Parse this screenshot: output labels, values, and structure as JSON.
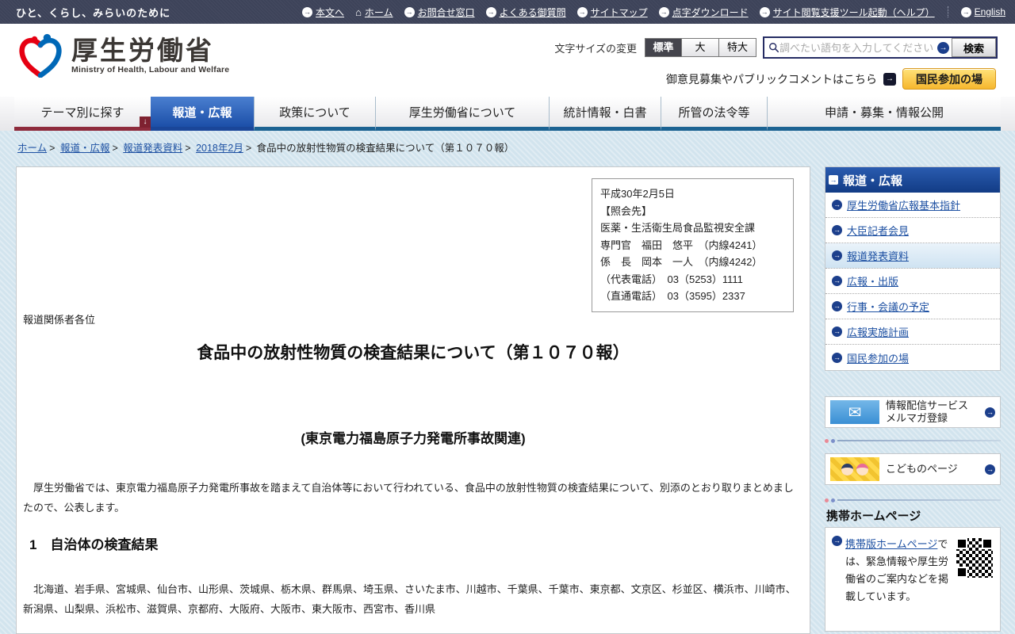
{
  "topbar": {
    "tagline": "ひと、くらし、みらいのために",
    "links": [
      "本文へ",
      "ホーム",
      "お問合せ窓口",
      "よくある御質問",
      "サイトマップ",
      "点字ダウンロード",
      "サイト閲覧支援ツール起動（ヘルプ）",
      "English"
    ]
  },
  "header": {
    "logo_title": "厚生労働省",
    "logo_subtitle": "Ministry of Health, Labour and Welfare",
    "font_size": {
      "label": "文字サイズの変更",
      "options": [
        "標準",
        "大",
        "特大"
      ],
      "active": "標準"
    },
    "search": {
      "placeholder": "調べたい語句を入力してください",
      "button": "検索"
    },
    "opinion_text": "御意見募集やパブリックコメントはこちら",
    "participation_button": "国民参加の場"
  },
  "nav": {
    "tabs": [
      "テーマ別に探す",
      "報道・広報",
      "政策について",
      "厚生労働省について",
      "統計情報・白書",
      "所管の法令等",
      "申請・募集・情報公開"
    ],
    "active": "報道・広報",
    "drop_arrow": "↓"
  },
  "breadcrumb": {
    "items": [
      "ホーム",
      "報道・広報",
      "報道発表資料",
      "2018年2月"
    ],
    "current": "食品中の放射性物質の検査結果について（第１０７０報）",
    "separator": ">"
  },
  "main": {
    "contact_box": {
      "lines": [
        "平成30年2月5日",
        "【照会先】",
        "医薬・生活衛生局食品監視安全課",
        "専門官　福田　悠平　（内線4241）",
        "係　長　岡本　一人　（内線4242）",
        "（代表電話）　03（5253）1111",
        "（直通電話）　03（3595）2337"
      ]
    },
    "salutation": "報道関係者各位",
    "title": "食品中の放射性物質の検査結果について（第１０７０報）",
    "subtitle": "(東京電力福島原子力発電所事故関連)",
    "intro": "　厚生労働省では、東京電力福島原子力発電所事故を踏まえて自治体等において行われている、食品中の放射性物質の検査結果について、別添のとおり取りまとめましたので、公表します。",
    "section1": {
      "heading": "1　自治体の検査結果",
      "body": "　北海道、岩手県、宮城県、仙台市、山形県、茨城県、栃木県、群馬県、埼玉県、さいたま市、川越市、千葉県、千葉市、東京都、文京区、杉並区、横浜市、川崎市、新潟県、山梨県、浜松市、滋賀県、京都府、大阪府、大阪市、東大阪市、西宮市、香川県"
    }
  },
  "sidebar": {
    "nav": {
      "title": "報道・広報",
      "items": [
        "厚生労働省広報基本指針",
        "大臣記者会見",
        "報道発表資料",
        "広報・出版",
        "行事・会議の予定",
        "広報実施計画",
        "国民参加の場"
      ],
      "active": "報道発表資料"
    },
    "banner_mail": {
      "line1": "情報配信サービス",
      "line2": "メルマガ登録"
    },
    "banner_kids": {
      "label": "こどものページ"
    },
    "mobile": {
      "heading": "携帯ホームページ",
      "link": "携帯版ホームページ",
      "text": "では、緊急情報や厚生労働省のご案内などを掲載しています。"
    }
  },
  "icons": {
    "arrow_right": "→",
    "arrow_down": "↓",
    "house": "⌂",
    "envelope": "✉"
  },
  "colors": {
    "topbar_bg": "#3d4359",
    "active_tab_blue": "#1c4fa8",
    "tab_underline_blue": "#1c6292",
    "theme_tab_red": "#8e2b3c",
    "page_bg_blue": "#d2e4ee",
    "link_blue": "#1d50a2",
    "sidebar_header_blue": "#123c85",
    "participation_yellow": "#f6b72e",
    "logo_red": "#e60012",
    "logo_blue": "#0068b7"
  }
}
